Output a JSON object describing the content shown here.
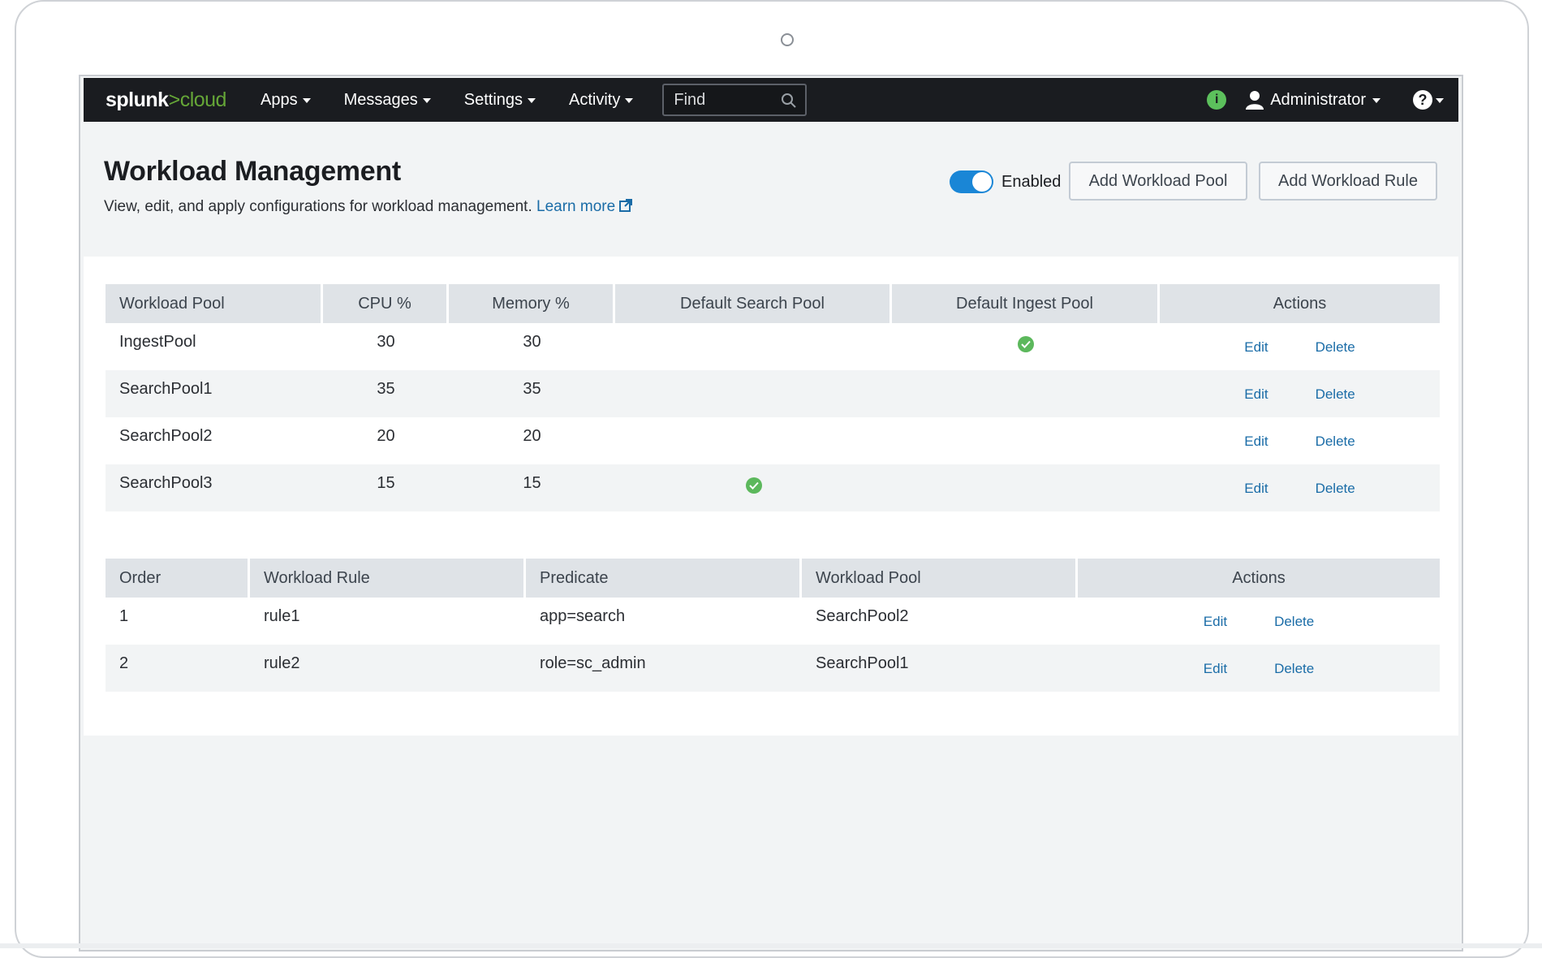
{
  "brand": {
    "logo_main": "splunk",
    "logo_gt": ">",
    "logo_sub": "cloud"
  },
  "nav": {
    "items": [
      {
        "label": "Apps"
      },
      {
        "label": "Messages"
      },
      {
        "label": "Settings"
      },
      {
        "label": "Activity"
      }
    ],
    "search_placeholder": "Find",
    "info_icon": "i",
    "user_label": "Administrator",
    "help_icon": "?"
  },
  "header": {
    "title": "Workload Management",
    "description": "View, edit, and apply configurations for workload management.",
    "learn_more": "Learn more",
    "toggle_label": "Enabled",
    "toggle_state": "on",
    "add_pool_button": "Add Workload Pool",
    "add_rule_button": "Add Workload Rule"
  },
  "pools_table": {
    "columns": [
      "Workload Pool",
      "CPU %",
      "Memory %",
      "Default Search Pool",
      "Default Ingest Pool",
      "Actions"
    ],
    "rows": [
      {
        "name": "IngestPool",
        "cpu": "30",
        "memory": "30",
        "default_search": false,
        "default_ingest": true
      },
      {
        "name": "SearchPool1",
        "cpu": "35",
        "memory": "35",
        "default_search": false,
        "default_ingest": false
      },
      {
        "name": "SearchPool2",
        "cpu": "20",
        "memory": "20",
        "default_search": false,
        "default_ingest": false
      },
      {
        "name": "SearchPool3",
        "cpu": "15",
        "memory": "15",
        "default_search": true,
        "default_ingest": false
      }
    ],
    "edit_label": "Edit",
    "delete_label": "Delete"
  },
  "rules_table": {
    "columns": [
      "Order",
      "Workload Rule",
      "Predicate",
      "Workload Pool",
      "Actions"
    ],
    "rows": [
      {
        "order": "1",
        "rule": "rule1",
        "predicate": "app=search",
        "pool": "SearchPool2"
      },
      {
        "order": "2",
        "rule": "rule2",
        "predicate": "role=sc_admin",
        "pool": "SearchPool1"
      }
    ],
    "edit_label": "Edit",
    "delete_label": "Delete"
  },
  "colors": {
    "nav_bg": "#1a1c20",
    "accent_green": "#65a637",
    "link_blue": "#1a6ca7",
    "toggle_blue": "#1a86d6",
    "check_green": "#5cb85c"
  }
}
